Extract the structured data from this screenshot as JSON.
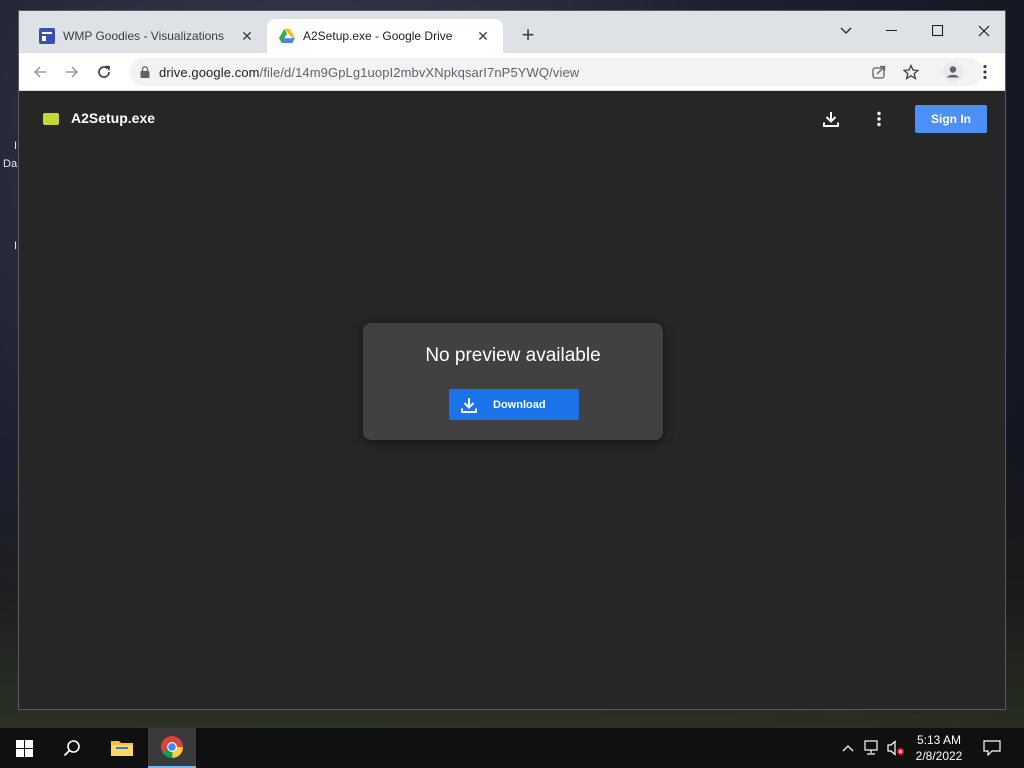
{
  "desktop": {
    "fragment_a": "I",
    "fragment_b": "Da",
    "fragment_c": "I"
  },
  "browser": {
    "tabs": [
      {
        "title": "WMP Goodies - Visualizations",
        "icon": "wmp-favicon",
        "active": false
      },
      {
        "title": "A2Setup.exe - Google Drive",
        "icon": "google-drive-icon",
        "active": true
      }
    ],
    "address": {
      "host": "drive.google.com",
      "path": "/file/d/14m9GpLg1uopI2mbvXNpkqsarI7nP5YWQ/view"
    }
  },
  "viewer": {
    "file_name": "A2Setup.exe",
    "sign_in_label": "Sign In",
    "message": "No preview available",
    "download_label": "Download"
  },
  "taskbar": {
    "time": "5:13 AM",
    "date": "2/8/2022"
  },
  "colors": {
    "drive_bg": "#262626",
    "card_bg": "#414141",
    "download_button": "#1a73e8",
    "sign_in_button": "#4e8ef7"
  }
}
